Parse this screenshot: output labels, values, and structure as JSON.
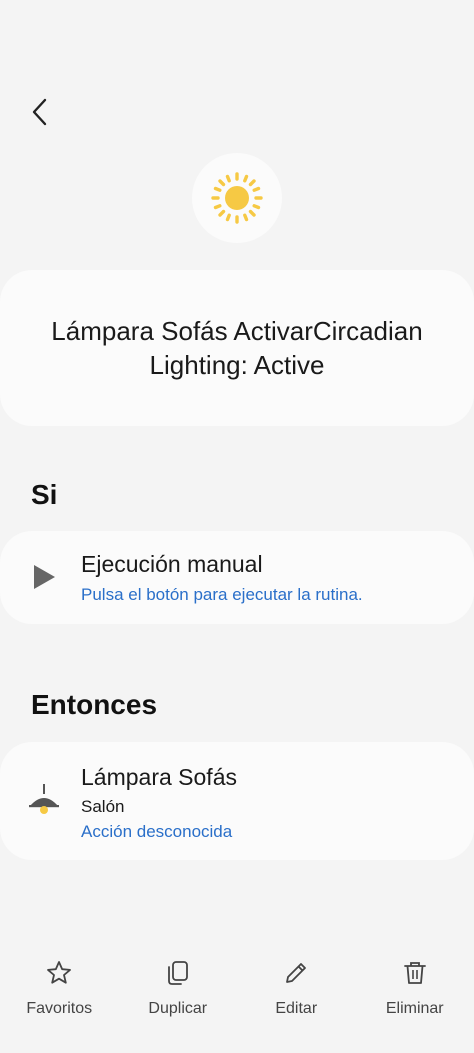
{
  "header": {
    "back_icon": "chevron-left-icon"
  },
  "routine": {
    "icon": "sun-icon",
    "icon_color": "#f6c944",
    "title": "Lámpara Sofás ActivarCircadian Lighting: Active"
  },
  "if_section": {
    "heading": "Si",
    "condition": {
      "icon": "play-icon",
      "title": "Ejecución manual",
      "subtitle": "Pulsa el botón para ejecutar la rutina."
    }
  },
  "then_section": {
    "heading": "Entonces",
    "action": {
      "icon": "lamp-icon",
      "title": "Lámpara Sofás",
      "room": "Salón",
      "status": "Acción desconocida"
    }
  },
  "bottom_bar": {
    "items": [
      {
        "label": "Favoritos",
        "icon": "star-icon"
      },
      {
        "label": "Duplicar",
        "icon": "copy-icon"
      },
      {
        "label": "Editar",
        "icon": "pencil-icon"
      },
      {
        "label": "Eliminar",
        "icon": "trash-icon"
      }
    ]
  },
  "colors": {
    "background": "#f4f4f4",
    "card": "#fbfbfb",
    "link_blue": "#2a6fc9"
  }
}
